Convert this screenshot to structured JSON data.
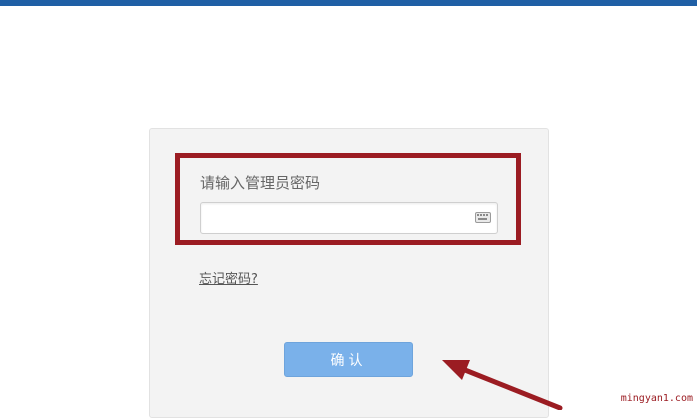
{
  "header": {
    "accent_color": "#1f5fa5"
  },
  "login": {
    "password_label": "请输入管理员密码",
    "password_value": "",
    "keyboard_icon": "keyboard-icon",
    "forgot_link": "忘记密码?",
    "confirm_label": "确认"
  },
  "annotation": {
    "highlight_color": "#9b1c22",
    "arrow_icon": "arrow-icon"
  },
  "watermark": {
    "text": "mingyan1.com"
  }
}
